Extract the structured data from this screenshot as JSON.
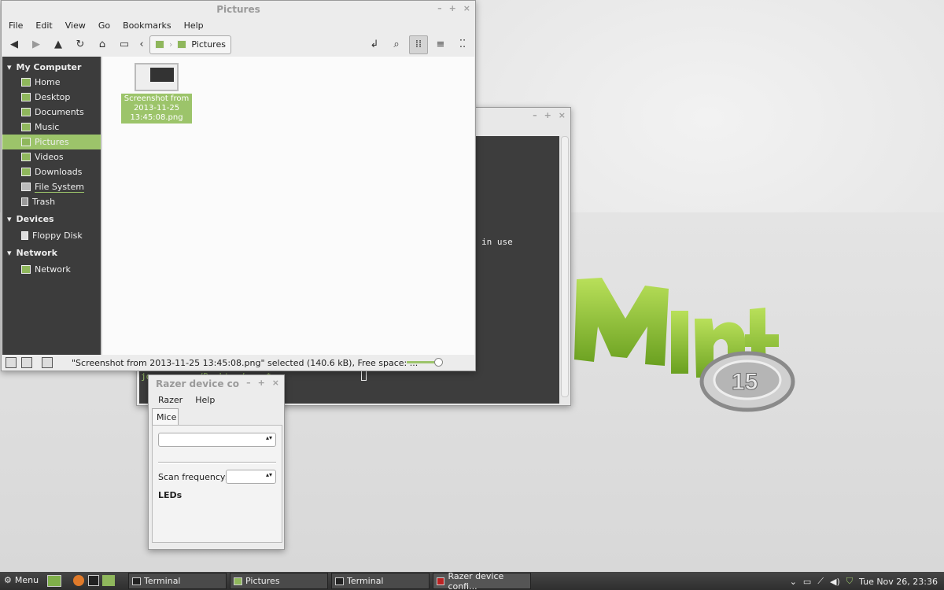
{
  "desktop": {
    "terminal_overflow_text": "in use",
    "terminal_prompt_visible": "jo.......:~/Desktop/app $"
  },
  "file_manager": {
    "title": "Pictures",
    "menu": [
      "File",
      "Edit",
      "View",
      "Go",
      "Bookmarks",
      "Help"
    ],
    "breadcrumb": "Pictures",
    "sidebar": {
      "my_computer": "My Computer",
      "items": [
        "Home",
        "Desktop",
        "Documents",
        "Music",
        "Pictures",
        "Videos",
        "Downloads",
        "File System",
        "Trash"
      ],
      "devices": "Devices",
      "device_items": [
        "Floppy Disk"
      ],
      "network": "Network",
      "network_items": [
        "Network"
      ]
    },
    "file": {
      "line1": "Screenshot from",
      "line2": "2013-11-25",
      "line3": "13:45:08.png"
    },
    "status": "\"Screenshot from 2013-11-25 13:45:08.png\" selected (140.6 kB), Free space: ...",
    "zoom_level": 0.7
  },
  "razer": {
    "title": "Razer device co",
    "menu": [
      "Razer",
      "Help"
    ],
    "tab": "Mice",
    "scan_label": "Scan frequency:",
    "leds_label": "LEDs"
  },
  "taskbar": {
    "menu_label": "Menu",
    "tasks": [
      "Terminal",
      "Pictures",
      "Terminal",
      "Razer device confi..."
    ],
    "clock": "Tue Nov 26, 23:36"
  },
  "colors": {
    "accent": "#9cc46a",
    "sidebar": "#3c3c3c",
    "terminal_bg": "#3d3d3d"
  }
}
